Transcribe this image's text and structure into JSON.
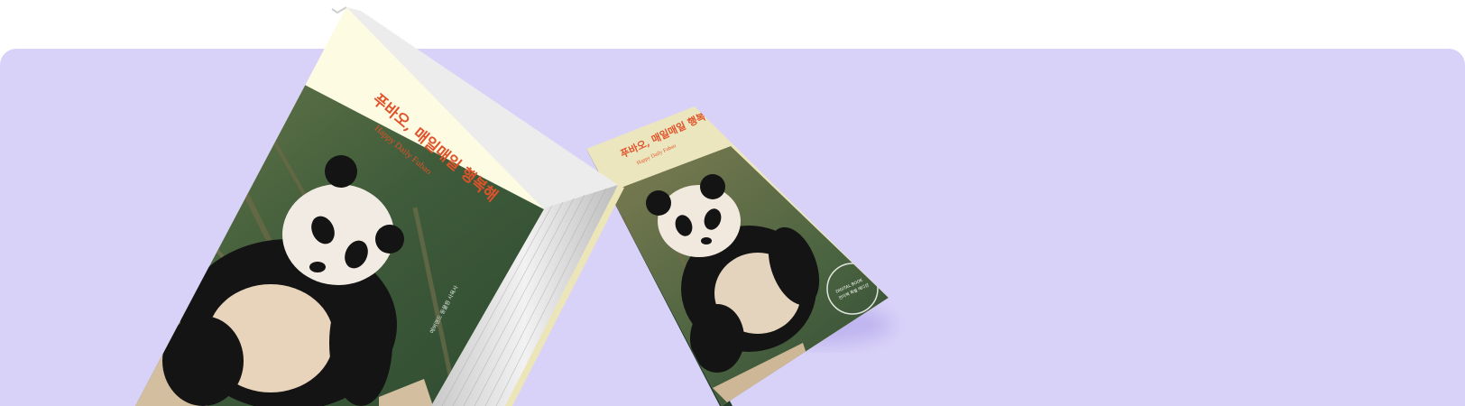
{
  "books": {
    "large": {
      "title": "푸바오, 매일매일 행복해",
      "subtitle": "Happy Daily Fubao",
      "spine_caption": "에버랜드 동물원 사육사"
    },
    "small": {
      "title": "푸바오, 매일매일 행복해",
      "subtitle": "Happy Daily Fubao",
      "seal_line1": "DIGITAL BOOK",
      "seal_line2": "전자책 특별 에디션"
    }
  },
  "colors": {
    "banner_bg": "#d9d2f8",
    "cover_top": "#fdfbe2",
    "title_accent": "#e0532a",
    "panda_black": "#141414",
    "bamboo_green": "#3f5a3a"
  }
}
